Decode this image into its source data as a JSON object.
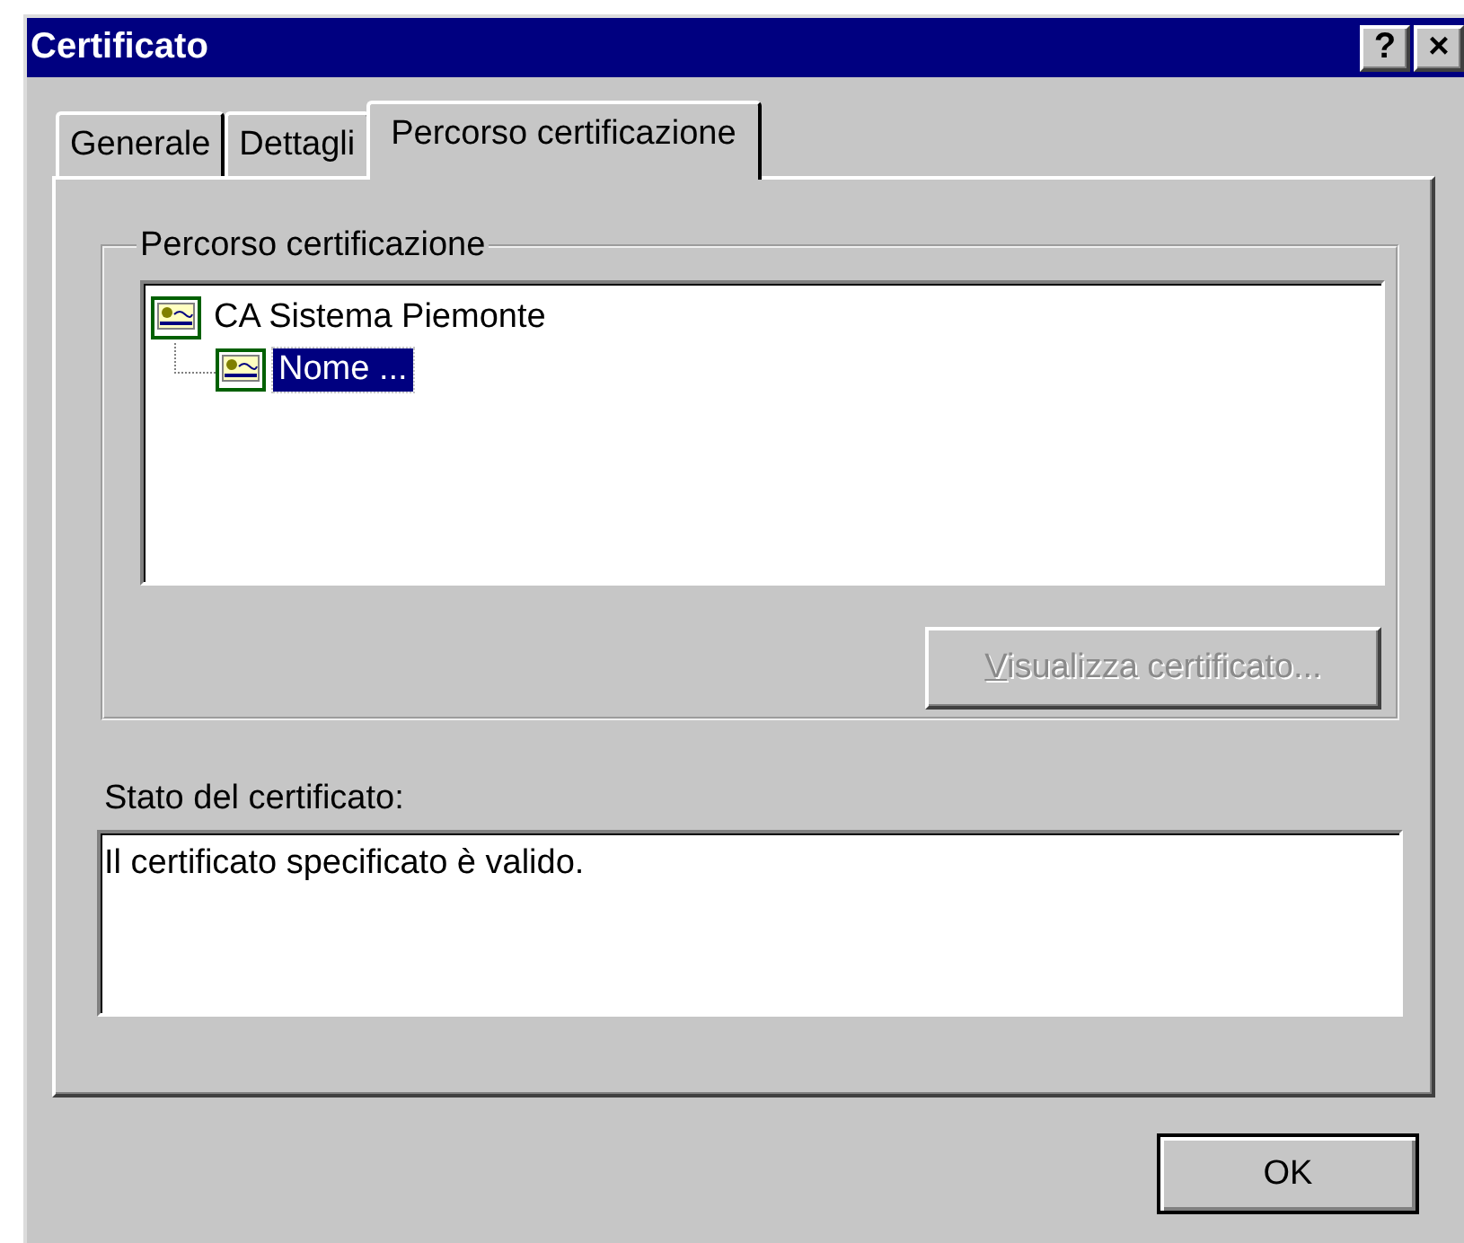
{
  "window": {
    "title": "Certificato",
    "title_buttons": [
      "?",
      "×"
    ]
  },
  "tabs": [
    {
      "label": "Generale",
      "selected": false
    },
    {
      "label": "Dettagli",
      "selected": false
    },
    {
      "label": "Percorso certificazione",
      "selected": true
    }
  ],
  "path_group": {
    "title": "Percorso certificazione",
    "tree": [
      {
        "label": "CA Sistema Piemonte",
        "selected": false,
        "children": [
          {
            "label": "Nome ...",
            "selected": true
          }
        ]
      }
    ],
    "view_button": {
      "label": "Visualizza certificato...",
      "disabled": true
    }
  },
  "status": {
    "label": "Stato del certificato:",
    "text": "Il certificato specificato è valido."
  },
  "buttons": [
    "OK"
  ]
}
